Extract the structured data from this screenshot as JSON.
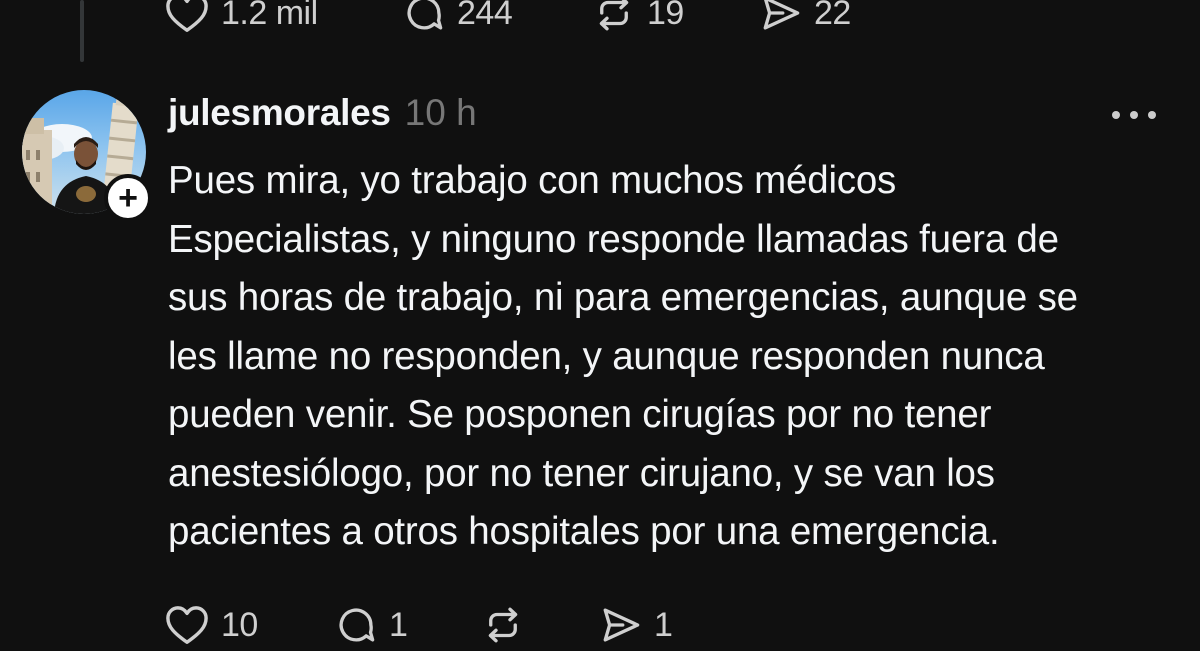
{
  "previous_post": {
    "likes": "1.2 mil",
    "replies": "244",
    "reposts": "19",
    "shares": "22"
  },
  "reply": {
    "username": "julesmorales",
    "time": "10 h",
    "follow_symbol": "+",
    "body_lines": [
      "Pues mira, yo trabajo con muchos médicos",
      "Especialistas, y ninguno responde llamadas fuera de",
      "sus horas de trabajo, ni para emergencias, aunque se",
      "les llame no responden, y aunque responden nunca",
      "pueden venir. Se posponen cirugías por no tener",
      "anestesiólogo, por no tener cirujano, y se van los",
      "pacientes a otros hospitales por una emergencia."
    ],
    "likes": "10",
    "replies": "1",
    "reposts": "",
    "shares": "1"
  },
  "icons": {
    "like": "heart-icon",
    "reply": "speech-bubble-icon",
    "repost": "repost-arrows-icon",
    "share": "send-paper-plane-icon",
    "more": "more-dots-icon"
  },
  "colors": {
    "background": "#101010",
    "text": "#f3f5f7",
    "muted": "#777777"
  }
}
